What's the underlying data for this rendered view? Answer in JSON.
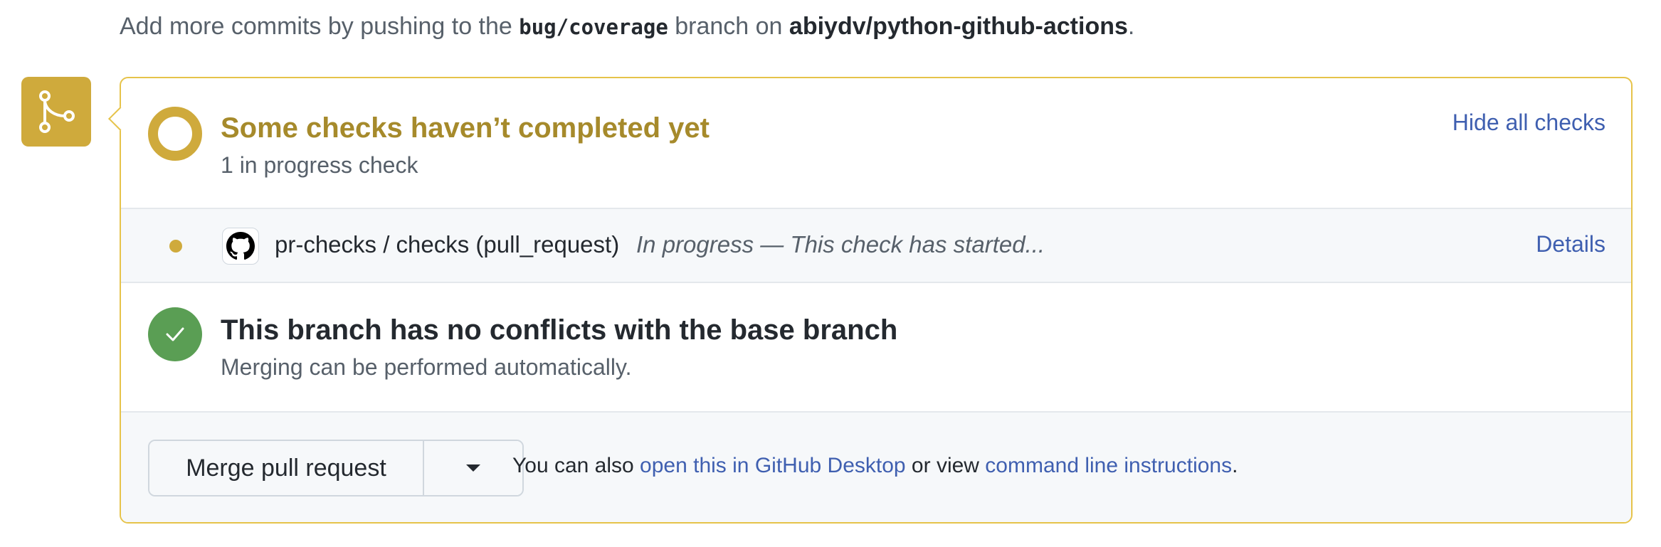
{
  "push_note": {
    "prefix": "Add more commits by pushing to the ",
    "branch": "bug/coverage",
    "middle": " branch on ",
    "repo": "abiydv/python-github-actions",
    "suffix": "."
  },
  "checks": {
    "title": "Some checks haven’t completed yet",
    "subtitle": "1 in progress check",
    "hide_link": "Hide all checks",
    "items": [
      {
        "name": "pr-checks / checks (pull_request)",
        "status": "In progress — This check has started...",
        "details_link": "Details",
        "icon": "github-icon",
        "status_color": "#cfaa3c"
      }
    ]
  },
  "conflicts": {
    "title": "This branch has no conflicts with the base branch",
    "subtitle": "Merging can be performed automatically."
  },
  "merge": {
    "button_label": "Merge pull request",
    "dropdown_icon": "triangle-down-icon",
    "also_prefix": "You can also ",
    "desktop_link": "open this in GitHub Desktop",
    "also_middle": " or view ",
    "cli_link": "command line instructions",
    "also_suffix": "."
  },
  "colors": {
    "pending": "#cfaa3c",
    "pending_text": "#a68a2b",
    "success": "#5a9e54",
    "link": "#3f5fb0"
  },
  "icons": {
    "badge": "git-merge-icon",
    "conflicts": "check-icon",
    "checks": "pending-ring-icon"
  }
}
